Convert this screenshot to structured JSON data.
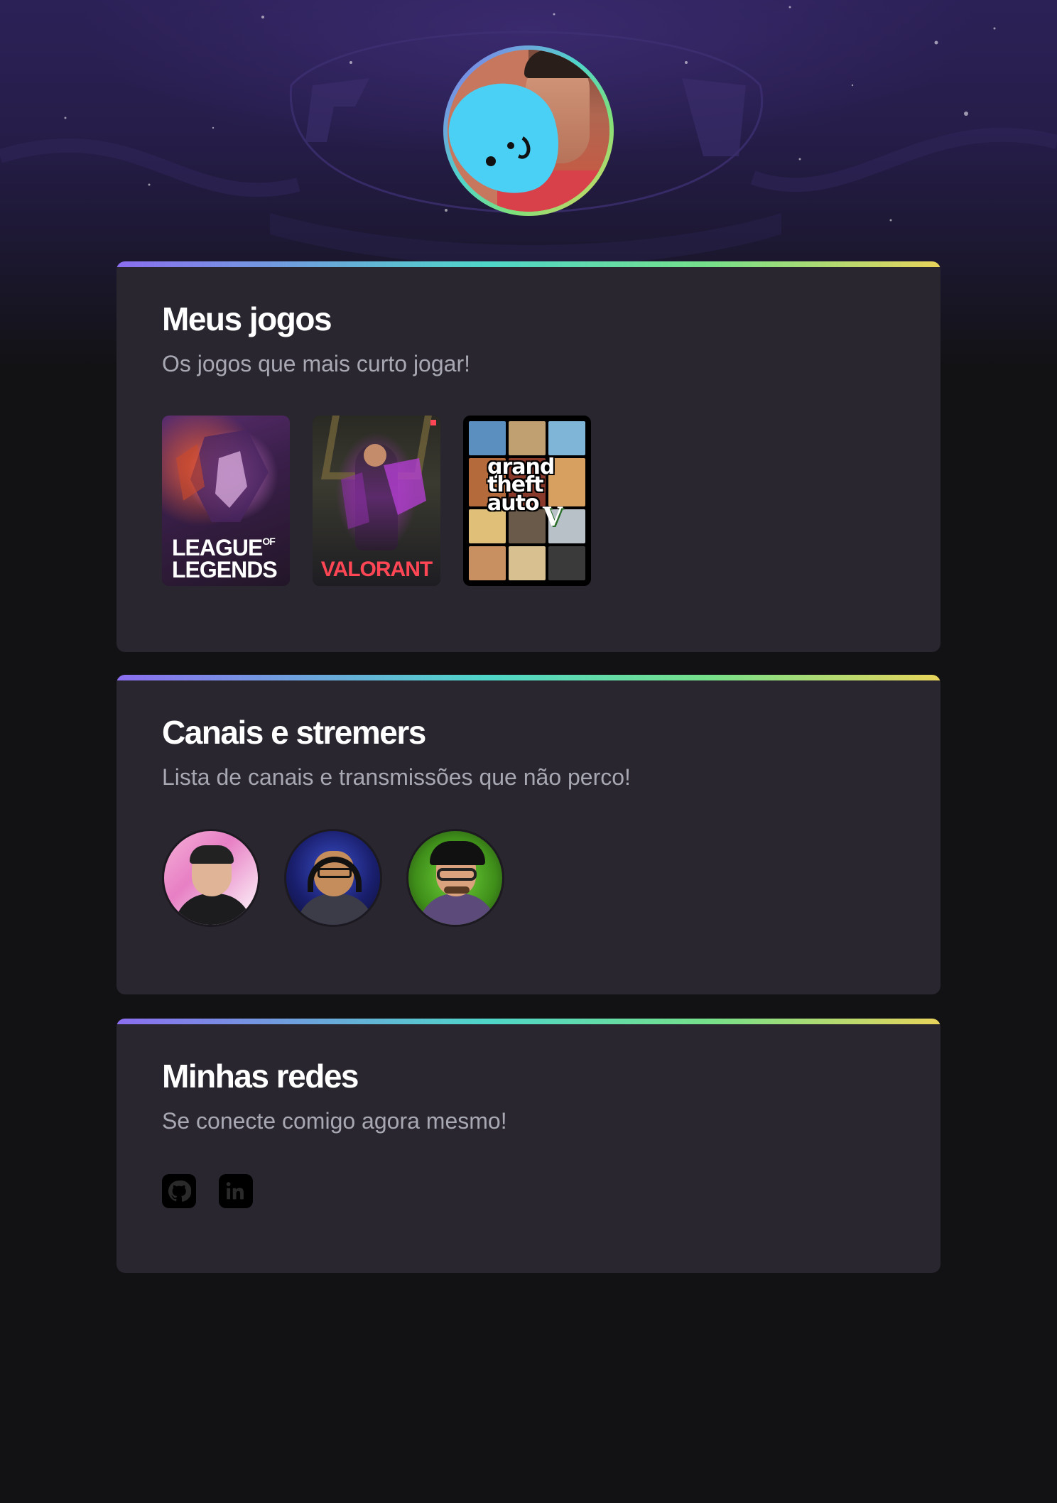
{
  "profile": {
    "avatar_alt": "Foto de perfil",
    "ring_colors": [
      "#8b6ef0",
      "#4fd6c9",
      "#7ee07a",
      "#e7d25b"
    ]
  },
  "sections": {
    "games": {
      "title": "Meus jogos",
      "subtitle": "Os jogos que mais curto jogar!",
      "items": [
        {
          "name": "League of Legends",
          "label_main": "LEAGUE",
          "label_of": "OF",
          "label_second": "LEGENDS"
        },
        {
          "name": "Valorant",
          "label": "VALORANT"
        },
        {
          "name": "Grand Theft Auto V",
          "label_lines": [
            "grand",
            "theft",
            "auto"
          ],
          "label_v": "V"
        }
      ]
    },
    "channels": {
      "title": "Canais e stremers",
      "subtitle": "Lista de canais e transmissões que não perco!",
      "items": [
        {
          "name": "channel-1"
        },
        {
          "name": "channel-2"
        },
        {
          "name": "channel-3"
        }
      ]
    },
    "socials": {
      "title": "Minhas redes",
      "subtitle": "Se conecte comigo agora mesmo!",
      "items": [
        {
          "name": "GitHub",
          "icon": "github-icon"
        },
        {
          "name": "LinkedIn",
          "icon": "linkedin-icon"
        }
      ]
    }
  },
  "colors": {
    "page_bg": "#121214",
    "card_bg": "#29262f",
    "title": "#ffffff",
    "subtitle": "#a8a8b3",
    "gradient": [
      "#8b6ef0",
      "#4fd6c9",
      "#76e08a",
      "#e8d45b"
    ]
  }
}
